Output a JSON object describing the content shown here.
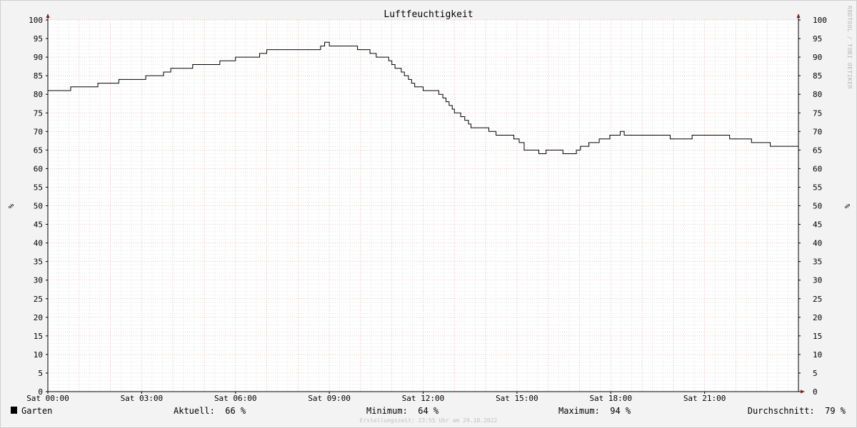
{
  "chart_data": {
    "type": "line",
    "title": "Luftfeuchtigkeit",
    "ylabel": "%",
    "ylim": [
      0,
      100
    ],
    "yticks": [
      0,
      5,
      10,
      15,
      20,
      25,
      30,
      35,
      40,
      45,
      50,
      55,
      60,
      65,
      70,
      75,
      80,
      85,
      90,
      95,
      100
    ],
    "xlim": [
      0,
      24
    ],
    "x_tick_hours": [
      0,
      3,
      6,
      9,
      12,
      15,
      18,
      21
    ],
    "x_tick_labels": [
      "Sat 00:00",
      "Sat 03:00",
      "Sat 06:00",
      "Sat 09:00",
      "Sat 12:00",
      "Sat 15:00",
      "Sat 18:00",
      "Sat 21:00"
    ],
    "grid": true,
    "series": [
      {
        "name": "Garten",
        "color": "#000000",
        "x_hours": [
          0,
          0.17,
          0.73,
          1.47,
          1.6,
          1.73,
          2.1,
          2.27,
          3.13,
          3.3,
          3.7,
          3.93,
          4.4,
          4.63,
          5.0,
          5.5,
          6.0,
          6.43,
          6.77,
          7.0,
          8.6,
          8.72,
          8.8,
          8.85,
          9.0,
          9.5,
          9.62,
          9.9,
          10.0,
          10.3,
          10.5,
          10.7,
          10.9,
          11.0,
          11.1,
          11.2,
          11.3,
          11.4,
          11.53,
          11.63,
          11.73,
          11.83,
          12.0,
          12.5,
          12.63,
          12.73,
          12.83,
          12.93,
          13.0,
          13.1,
          13.2,
          13.33,
          13.45,
          13.53,
          13.65,
          13.8,
          14.1,
          14.33,
          14.53,
          14.9,
          15.07,
          15.23,
          15.53,
          15.7,
          15.8,
          15.93,
          16.07,
          16.47,
          16.57,
          16.9,
          17.03,
          17.13,
          17.3,
          17.63,
          17.97,
          18.17,
          18.3,
          18.43,
          18.7,
          19.13,
          19.9,
          20.6,
          21.8,
          22.5,
          22.6,
          23.1,
          24
        ],
        "values": [
          81,
          81,
          82,
          82,
          83,
          83,
          83,
          84,
          85,
          85,
          86,
          87,
          87,
          88,
          88,
          89,
          90,
          90,
          91,
          92,
          92,
          93,
          93,
          94,
          93,
          93,
          93,
          92,
          92,
          91,
          90,
          90,
          89,
          88,
          87,
          87,
          86,
          85,
          84,
          83,
          82,
          82,
          81,
          80,
          79,
          78,
          77,
          76,
          75,
          75,
          74,
          73,
          72,
          71,
          71,
          71,
          70,
          69,
          69,
          68,
          67,
          65,
          65,
          64,
          64,
          65,
          65,
          64,
          64,
          65,
          66,
          66,
          67,
          68,
          69,
          69,
          70,
          69,
          69,
          69,
          68,
          69,
          68,
          67,
          67,
          66,
          66
        ]
      }
    ]
  },
  "watermark": "RRDTOOL / TOBI OETIKER",
  "legend": {
    "series_name": "Garten",
    "swatch_color": "#000000",
    "current": "Aktuell:  66 %",
    "minimum": "Minimum:  64 %",
    "maximum": "Maximum:  94 %",
    "average": "Durchschnitt:  79 %"
  },
  "created": "Erstellungszeit: 23:55 Uhr am 29.10.2022",
  "colors": {
    "background": "#f3f3f3",
    "plot_background": "#ffffff",
    "major_grid": "#e8a6a6",
    "minor_grid": "#d3d3d3",
    "axis": "#000000",
    "arrow": "#8b1a1a"
  }
}
